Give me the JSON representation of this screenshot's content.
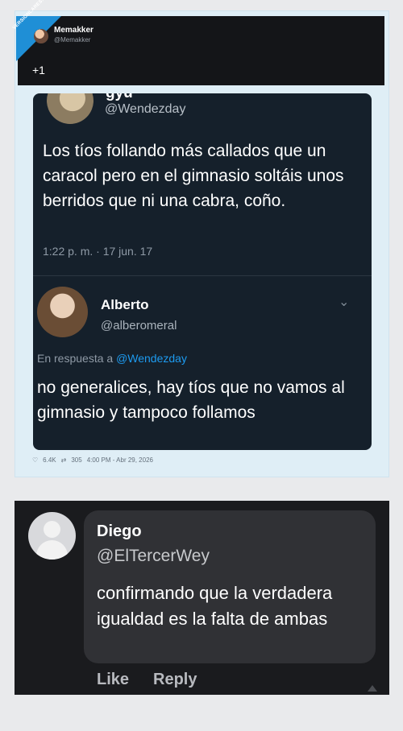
{
  "header": {
    "badge": "VERSIONLARES.COM",
    "user_name": "Memakker",
    "user_handle": "@Memakker",
    "count": "+1"
  },
  "tweet": {
    "partial_name": "gyu",
    "handle": "@Wendezday",
    "text": "Los tíos follando más callados que un caracol pero en el gimnasio soltáis unos berridos que ni una cabra, coño.",
    "time": "1:22 p. m. · 17 jun. 17"
  },
  "reply": {
    "name": "Alberto",
    "handle": "@alberomeral",
    "prefix": "En respuesta a",
    "mention": "@Wendezday",
    "text": "no generalices, hay tíos que no vamos al gimnasio y tampoco follamos"
  },
  "tweet_actions": {
    "likes": "6.4K",
    "retweets": "305",
    "timestamp": "4:00 PM - Abr 29, 2026"
  },
  "comment": {
    "name": "Diego",
    "handle": "@ElTercerWey",
    "text": "confirmando que la verdadera igualdad es la falta de ambas",
    "like_label": "Like",
    "reply_label": "Reply"
  },
  "icons": {
    "like": "heart-icon",
    "retweet": "retweet-icon",
    "chevron": "chevron-down-icon"
  }
}
